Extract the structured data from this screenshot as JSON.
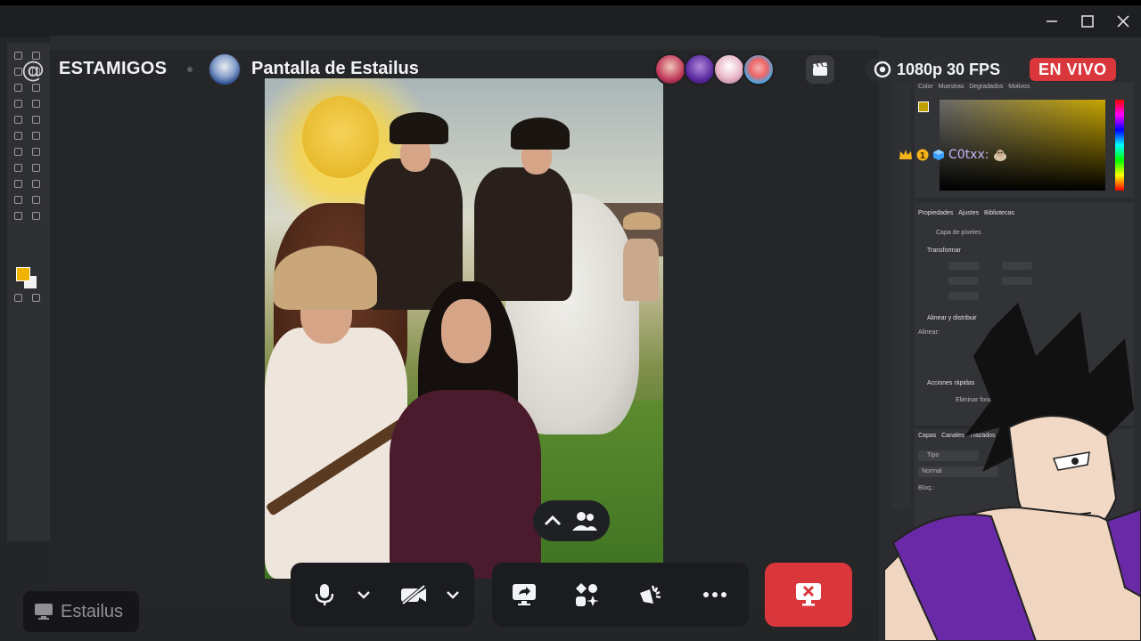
{
  "window": {
    "minimize_icon": "minimize-icon",
    "maximize_icon": "maximize-icon",
    "close_icon": "close-icon"
  },
  "header": {
    "channel_icon": "at-icon",
    "server_name": "ESTAMIGOS",
    "streamer_avatar": "streamer-avatar",
    "stream_title": "Pantalla de Estailus",
    "viewers": [
      {
        "avatar": "viewer-avatar-1",
        "color": "#c23a5a"
      },
      {
        "avatar": "viewer-avatar-2",
        "color": "#5a2aa0"
      },
      {
        "avatar": "viewer-avatar-3",
        "color": "#e9b7c9"
      },
      {
        "avatar": "viewer-avatar-4",
        "color": "#4aa6e0"
      }
    ],
    "activity_icon": "clapperboard-icon",
    "quality": "1080p 30 FPS",
    "quality_icon": "eye-icon",
    "live_label": "EN VIVO",
    "live_color": "#da373c"
  },
  "overlay": {
    "chat_user": "C0txx:",
    "chat_badges": [
      "crown-icon",
      "rank-1-badge",
      "cube-icon"
    ],
    "chat_emote": "dog-emote"
  },
  "photoshop": {
    "panel_tabs_top": [
      "Color",
      "Muestras",
      "Degradados",
      "Motivos"
    ],
    "panel_tabs_props": [
      "Propiedades",
      "Ajustes",
      "Bibliotecas"
    ],
    "layer_kind": "Capa de píxeles",
    "transform_label": "Transformar",
    "align_label": "Alinear y distribuir",
    "align_sub": "Alinear:",
    "quick_actions": "Acciones rápidas",
    "remove_bg": "Eliminar fondo",
    "layers_tabs": [
      "Capas",
      "Canales",
      "Trazados"
    ],
    "layers_filter": "Tipo",
    "layers_blend": "Normal",
    "lock_label": "Bloq.:",
    "foreground_color": "#f0b400"
  },
  "controls": {
    "mic_icon": "microphone-icon",
    "mic_menu_icon": "chevron-down-icon",
    "camera_icon": "camera-off-icon",
    "camera_menu_icon": "chevron-down-icon",
    "share_icon": "screen-share-icon",
    "activity_icon": "activities-icon",
    "soundboard_icon": "soundboard-icon",
    "more_icon": "more-icon",
    "leave_icon": "leave-call-icon",
    "popout_up_icon": "chevron-up-icon",
    "popout_people_icon": "people-icon"
  },
  "name_tag": {
    "icon": "screen-icon",
    "name": "Estailus"
  }
}
